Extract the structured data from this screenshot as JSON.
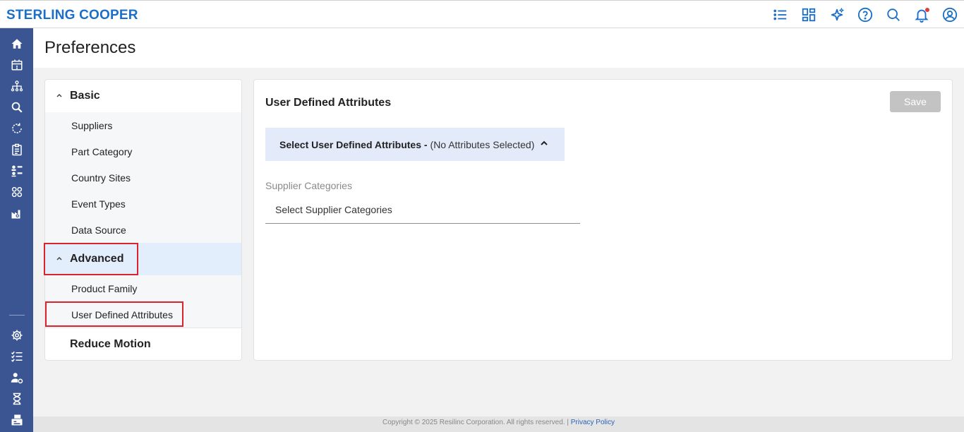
{
  "app": {
    "brand": "STERLING COOPER"
  },
  "topbar": {
    "icons": [
      "list-icon",
      "dashboard-icon",
      "sparkle-icon",
      "help-icon",
      "search-icon",
      "bell-icon",
      "user-icon"
    ],
    "accent": "#1b6fc8",
    "notification_color": "#e23b3b"
  },
  "rail": {
    "color": "#3a5592",
    "top_icons": [
      "home-icon",
      "calendar-alert-icon",
      "network-icon",
      "search-person-icon",
      "refresh-icon",
      "clipboard-icon",
      "org-icon",
      "apps-icon",
      "factory-icon"
    ],
    "bottom_icons": [
      "settings-icon",
      "checklist-icon",
      "user-settings-icon",
      "hourglass-icon",
      "printer-icon"
    ]
  },
  "page": {
    "title": "Preferences"
  },
  "nav": {
    "basic": {
      "label": "Basic",
      "items": [
        "Suppliers",
        "Part Category",
        "Country Sites",
        "Event Types",
        "Data Source"
      ]
    },
    "advanced": {
      "label": "Advanced",
      "items": [
        "Product Family",
        "User Defined Attributes"
      ]
    },
    "reduce_motion": {
      "label": "Reduce Motion"
    }
  },
  "main": {
    "title": "User Defined Attributes",
    "save_label": "Save",
    "select_bar": {
      "bold": "Select User Defined Attributes -",
      "status": "(No Attributes Selected)"
    },
    "field": {
      "label": "Supplier Categories",
      "placeholder": "Select Supplier Categories"
    }
  },
  "footer": {
    "copyright": "Copyright © 2025 Resilinc Corporation. All rights reserved. |",
    "privacy": "Privacy Policy"
  }
}
